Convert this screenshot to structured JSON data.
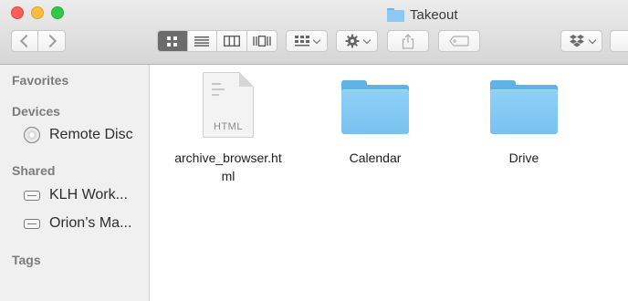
{
  "window": {
    "title": "Takeout"
  },
  "toolbar": {
    "back_icon": "chevron-left-icon",
    "forward_icon": "chevron-right-icon",
    "views": [
      {
        "name": "icon-view",
        "active": true
      },
      {
        "name": "list-view",
        "active": false
      },
      {
        "name": "column-view",
        "active": false
      },
      {
        "name": "cover-flow-view",
        "active": false
      }
    ],
    "arrange_icon": "arrange-grid-icon",
    "action_icon": "gear-icon",
    "share_icon": "share-icon",
    "tag_icon": "tag-icon",
    "dropbox_icon": "dropbox-icon"
  },
  "sidebar": {
    "favorites_heading": "Favorites",
    "devices_heading": "Devices",
    "devices": [
      {
        "label": "Remote Disc",
        "icon": "disc-icon"
      }
    ],
    "shared_heading": "Shared",
    "shared": [
      {
        "label": "KLH Work...",
        "icon": "network-drive-icon"
      },
      {
        "label": "Orion’s Ma...",
        "icon": "network-drive-icon"
      }
    ],
    "tags_heading": "Tags"
  },
  "files": [
    {
      "name_line1": "archive_browser.ht",
      "name_line2": "ml",
      "type": "HTML",
      "icon": "html-document-icon"
    },
    {
      "name": "Calendar",
      "icon": "folder-icon"
    },
    {
      "name": "Drive",
      "icon": "folder-icon"
    }
  ],
  "colors": {
    "folder": "#7ec4f1",
    "close": "#fc605c",
    "minimize": "#fdbc40",
    "maximize": "#34c84a",
    "sidebar_bg": "#f0f0f0"
  }
}
